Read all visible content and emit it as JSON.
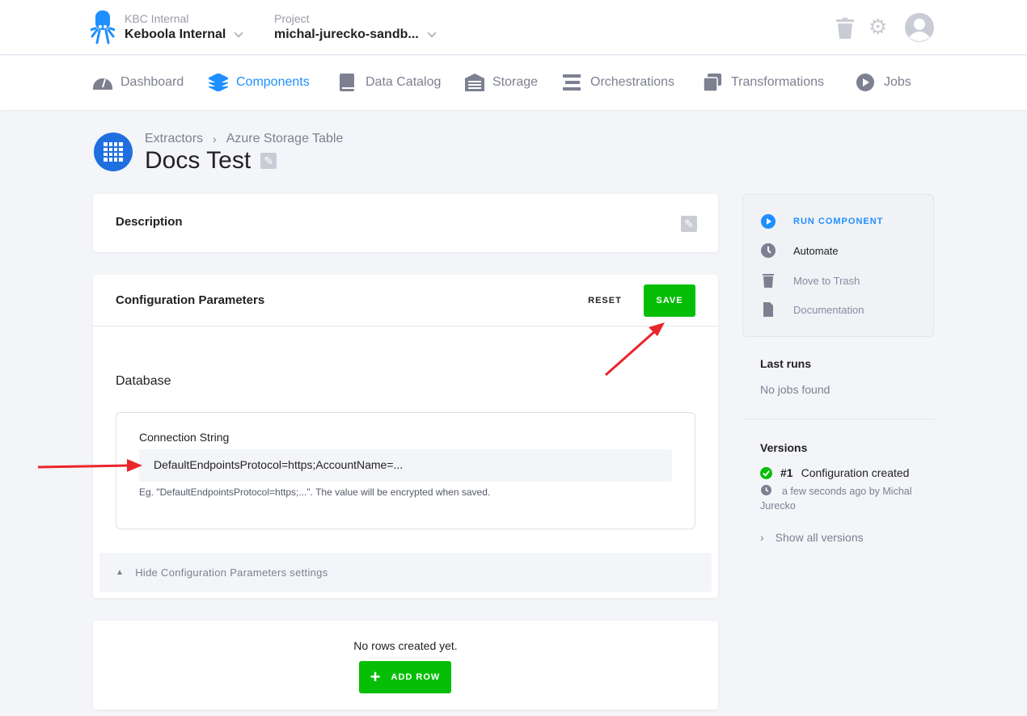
{
  "header": {
    "org_label": "KBC Internal",
    "org_name": "Keboola Internal",
    "project_label": "Project",
    "project_name": "michal-jurecko-sandb..."
  },
  "nav": [
    {
      "label": "Dashboard",
      "icon": "gauge-icon"
    },
    {
      "label": "Components",
      "icon": "layers-icon",
      "active": true
    },
    {
      "label": "Data Catalog",
      "icon": "book-icon"
    },
    {
      "label": "Storage",
      "icon": "warehouse-icon"
    },
    {
      "label": "Orchestrations",
      "icon": "bars-icon"
    },
    {
      "label": "Transformations",
      "icon": "window-icon"
    },
    {
      "label": "Jobs",
      "icon": "play-icon"
    }
  ],
  "breadcrumb": [
    "Extractors",
    "Azure Storage Table"
  ],
  "page_title": "Docs Test",
  "description": {
    "title": "Description"
  },
  "config": {
    "title": "Configuration Parameters",
    "reset_label": "RESET",
    "save_label": "SAVE",
    "section_title": "Database",
    "field_label": "Connection String",
    "field_value": "DefaultEndpointsProtocol=https;AccountName=...",
    "field_help": "Eg. \"DefaultEndpointsProtocol=https;...\". The value will be encrypted when saved.",
    "toggle_label": "Hide Configuration Parameters settings"
  },
  "rows": {
    "empty_text": "No rows created yet.",
    "add_label": "ADD ROW"
  },
  "sidebar": {
    "actions": [
      {
        "label": "RUN COMPONENT",
        "icon": "play-circle-icon"
      },
      {
        "label": "Automate",
        "icon": "clock-icon"
      },
      {
        "label": "Move to Trash",
        "icon": "trash-icon"
      },
      {
        "label": "Documentation",
        "icon": "document-icon"
      }
    ],
    "last_runs_title": "Last runs",
    "last_runs_empty": "No jobs found",
    "versions_title": "Versions",
    "version_number": "#1",
    "version_desc": "Configuration created",
    "version_meta": "a few seconds ago by Michal Jurecko",
    "show_all": "Show all versions"
  },
  "colors": {
    "accent": "#1f8fff",
    "success": "#07be07",
    "annotation_arrow": "#e8262b"
  }
}
